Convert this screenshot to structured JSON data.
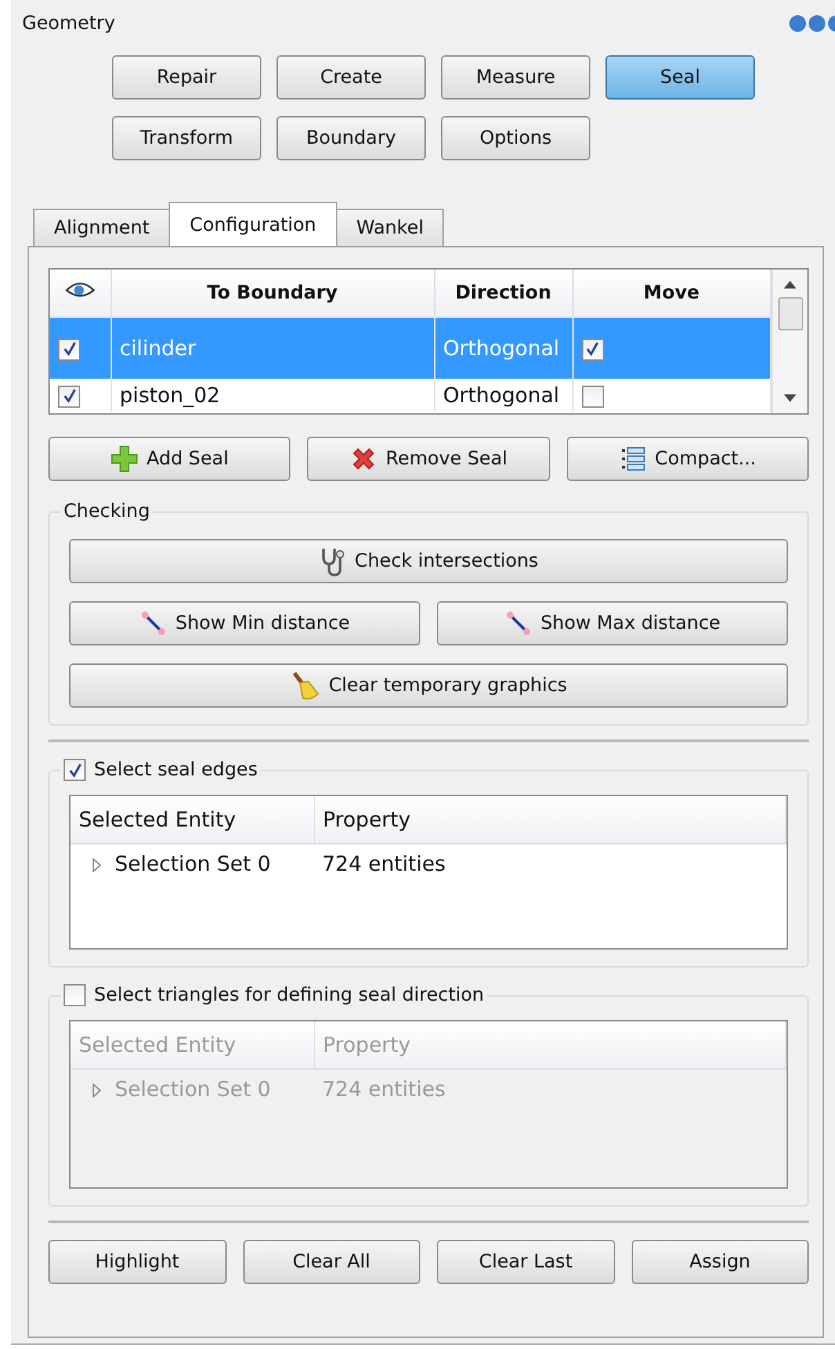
{
  "panel": {
    "title": "Geometry"
  },
  "modes": [
    {
      "label": "Repair",
      "selected": false
    },
    {
      "label": "Create",
      "selected": false
    },
    {
      "label": "Measure",
      "selected": false
    },
    {
      "label": "Seal",
      "selected": true
    },
    {
      "label": "Transform",
      "selected": false
    },
    {
      "label": "Boundary",
      "selected": false
    },
    {
      "label": "Options",
      "selected": false
    }
  ],
  "tabs": [
    {
      "label": "Alignment",
      "selected": false
    },
    {
      "label": "Configuration",
      "selected": true
    },
    {
      "label": "Wankel",
      "selected": false
    }
  ],
  "seal_table": {
    "columns": [
      "To Boundary",
      "Direction",
      "Move"
    ],
    "rows": [
      {
        "visible": true,
        "boundary": "cilinder",
        "direction": "Orthogonal",
        "move": true,
        "selected": true
      },
      {
        "visible": true,
        "boundary": "piston_02",
        "direction": "Orthogonal",
        "move": false,
        "selected": false
      }
    ]
  },
  "seal_buttons": [
    {
      "label": "Add Seal",
      "kind": "add"
    },
    {
      "label": "Remove Seal",
      "kind": "remove"
    },
    {
      "label": "Compact...",
      "kind": "list"
    }
  ],
  "checking": {
    "title": "Checking",
    "rows": [
      [
        {
          "label": "Check intersections",
          "kind": "stethoscope"
        }
      ],
      [
        {
          "label": "Show Min distance",
          "kind": "distance"
        },
        {
          "label": "Show Max distance",
          "kind": "distance"
        }
      ],
      [
        {
          "label": "Clear temporary graphics",
          "kind": "broom"
        }
      ]
    ]
  },
  "selection_groups": [
    {
      "label": "Select seal edges",
      "checked": true,
      "disabled": false,
      "columns": [
        "Selected Entity",
        "Property"
      ],
      "rows": [
        {
          "entity": "Selection Set 0",
          "property": "724 entities"
        }
      ]
    },
    {
      "label": "Select triangles for defining seal direction",
      "checked": false,
      "disabled": true,
      "columns": [
        "Selected Entity",
        "Property"
      ],
      "rows": [
        {
          "entity": "Selection Set 0",
          "property": "724 entities"
        }
      ]
    }
  ],
  "actions": [
    "Highlight",
    "Clear All",
    "Clear Last",
    "Assign"
  ]
}
